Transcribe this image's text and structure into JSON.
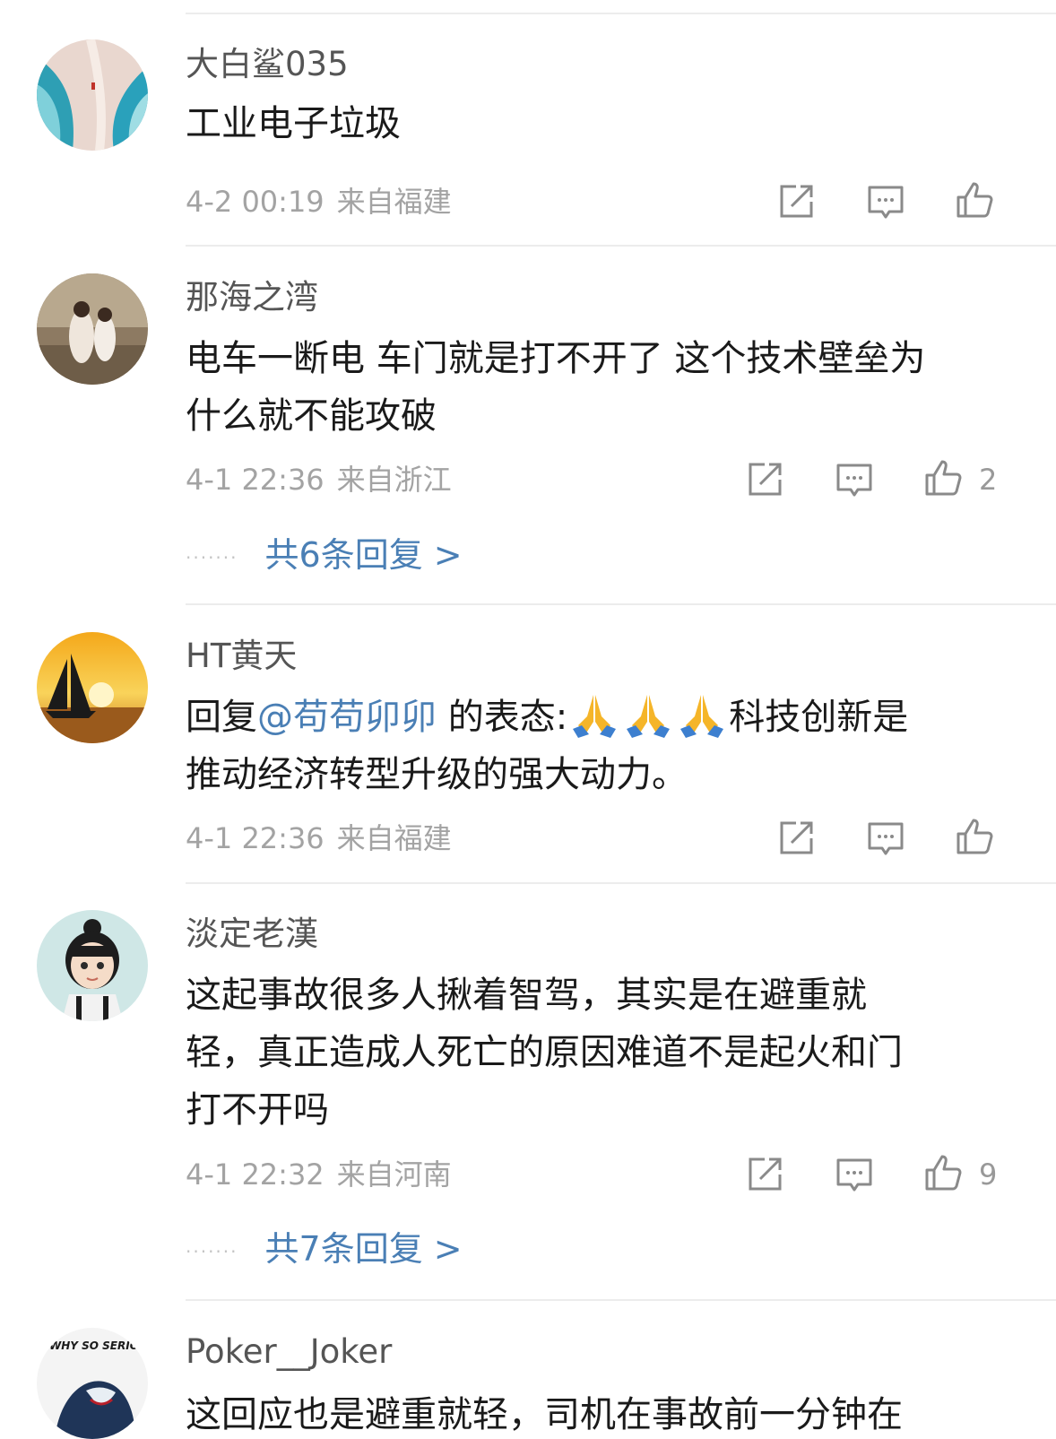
{
  "colors": {
    "link": "#4a7fb5",
    "meta": "#a3a3a3",
    "icon": "#8a8a8a",
    "divider": "#ececec"
  },
  "comments": [
    {
      "username": "大白鲨035",
      "text": "工业电子垃圾",
      "time": "4-2 00:19",
      "location": "来自福建",
      "like_count": "",
      "replies": ""
    },
    {
      "username": "那海之湾",
      "text_line1": "电车一断电 车门就是打不开了 这个技术壁垒为",
      "text_line2": "什么就不能攻破",
      "time": "4-1 22:36",
      "location": "来自浙江",
      "like_count": "2",
      "replies": "共6条回复 >"
    },
    {
      "username": "HT黄天",
      "reply_prefix": "回复",
      "mention": "@苟苟卯卯",
      "text_mid": " 的表态:",
      "emoji": "folded-hands",
      "text_after": "科技创新是",
      "text_line2": "推动经济转型升级的强大动力。",
      "time": "4-1 22:36",
      "location": "来自福建",
      "like_count": "",
      "replies": ""
    },
    {
      "username": "淡定老漢",
      "text_line1": "这起事故很多人揪着智驾，其实是在避重就",
      "text_line2": "轻，真正造成人死亡的原因难道不是起火和门",
      "text_line3": "打不开吗",
      "time": "4-1 22:32",
      "location": "来自河南",
      "like_count": "9",
      "replies": "共7条回复 >"
    },
    {
      "username": "Poker__Joker",
      "text_partial": "这回应也是避重就轻，司机在事故前一分钟在"
    }
  ],
  "icons": {
    "share": "share-icon",
    "comment": "comment-icon",
    "like": "thumbs-up-icon",
    "avatar_text": "WHY SO SERIOUS?"
  }
}
